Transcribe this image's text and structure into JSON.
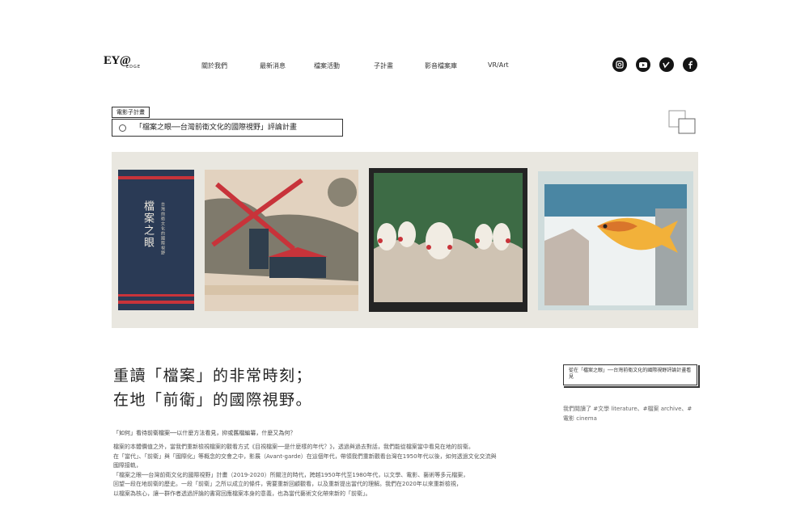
{
  "header": {
    "logo_main": "EY@",
    "logo_sub": "EDGE",
    "nav": [
      "關於我們",
      "最新消息",
      "檔案活動",
      "子計畫",
      "影音檔案庫",
      "VR/Art"
    ],
    "social_icons": [
      "instagram-icon",
      "youtube-icon",
      "vimeo-icon",
      "facebook-icon"
    ]
  },
  "project": {
    "tag": "電影子計畫",
    "title": "「檔案之眼──台灣前衛文化的國際視野」評論計畫"
  },
  "banner": {
    "book_title": "檔案之眼",
    "book_subtitle": "台灣前衛文化的國際視野"
  },
  "article": {
    "headline_1": "重讀「檔案」的非常時刻；",
    "headline_2": "在地「前衛」的國際視野。",
    "question": "「如何」看待前衛檔案──以什麼方法看見，抑或舊檔編纂，什麼又為何？",
    "body": [
      "檔案的本體價值之外，當我們重新檢視檔案的觀看方式《目視檔案──是什麼樣的年代？》，透過與過去對話，我們能從檔案當中看見在地的前衛。",
      "在「當代」、「前衛」與「國際化」等概念的交會之中，影展（Avant-garde）在這個年代，帶領我們重新觀看台灣在1950年代以後，如何透過文化交流與國際接軌，",
      "「檔案之眼──台灣前衛文化的國際視野」計畫（2019-2020）所關注的時代，跨越1950年代至1980年代，以文學、電影、藝術等多元檔案，",
      "回望一段在地前衛的歷史。一段「前衛」之所以成立的條件，需要重新回顧觀看，以及重新提出當代的理解。我們在2020年以來重新檢視，",
      "以檔案為核心，讓一群作者透過評論的書寫回應檔案本身的意義，也為當代藝術文化帶來新的「前衛」。"
    ]
  },
  "sidebar": {
    "box_text": "從在「檔案之眼」──台灣前衛文化的國際視野評論計畫看見",
    "note": "我們閱讀了 #文學 literature、#檔案 archive、#電影 cinema"
  },
  "colors": {
    "text": "#222222",
    "banner_bg": "#e9e7e0",
    "book_navy": "#2a3a55",
    "accent_red": "#c8333a",
    "panel_green": "#3d6b45"
  }
}
